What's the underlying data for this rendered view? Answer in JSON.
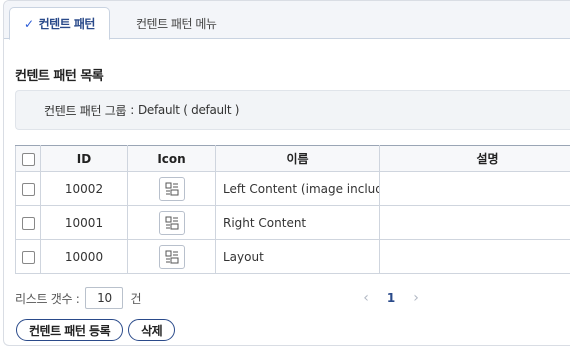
{
  "tabs": [
    {
      "label": "컨텐트 패턴",
      "active": true
    },
    {
      "label": "컨텐트 패턴 메뉴",
      "active": false
    }
  ],
  "section_title": "컨텐트 패턴 목록",
  "group": {
    "label": "컨텐트 패턴 그룹",
    "value": "Default ( default )"
  },
  "table": {
    "headers": {
      "id": "ID",
      "icon": "Icon",
      "name": "이름",
      "desc": "설명"
    },
    "rows": [
      {
        "id": "10002",
        "name": "Left Content (image included)",
        "desc": ""
      },
      {
        "id": "10001",
        "name": "Right Content",
        "desc": ""
      },
      {
        "id": "10000",
        "name": "Layout",
        "desc": ""
      }
    ]
  },
  "list_count": {
    "label": "리스트 갯수 :",
    "value": "10",
    "unit": "건"
  },
  "pager": {
    "prev": "‹",
    "current": "1",
    "next": "›"
  },
  "buttons": {
    "register": "컨텐트 패턴 등록",
    "delete": "삭제"
  },
  "colors": {
    "accent": "#2a4a8a",
    "check": "#2a5bd7",
    "tab_bg": "#f3f5f9",
    "group_bg": "#f2f4f7"
  }
}
